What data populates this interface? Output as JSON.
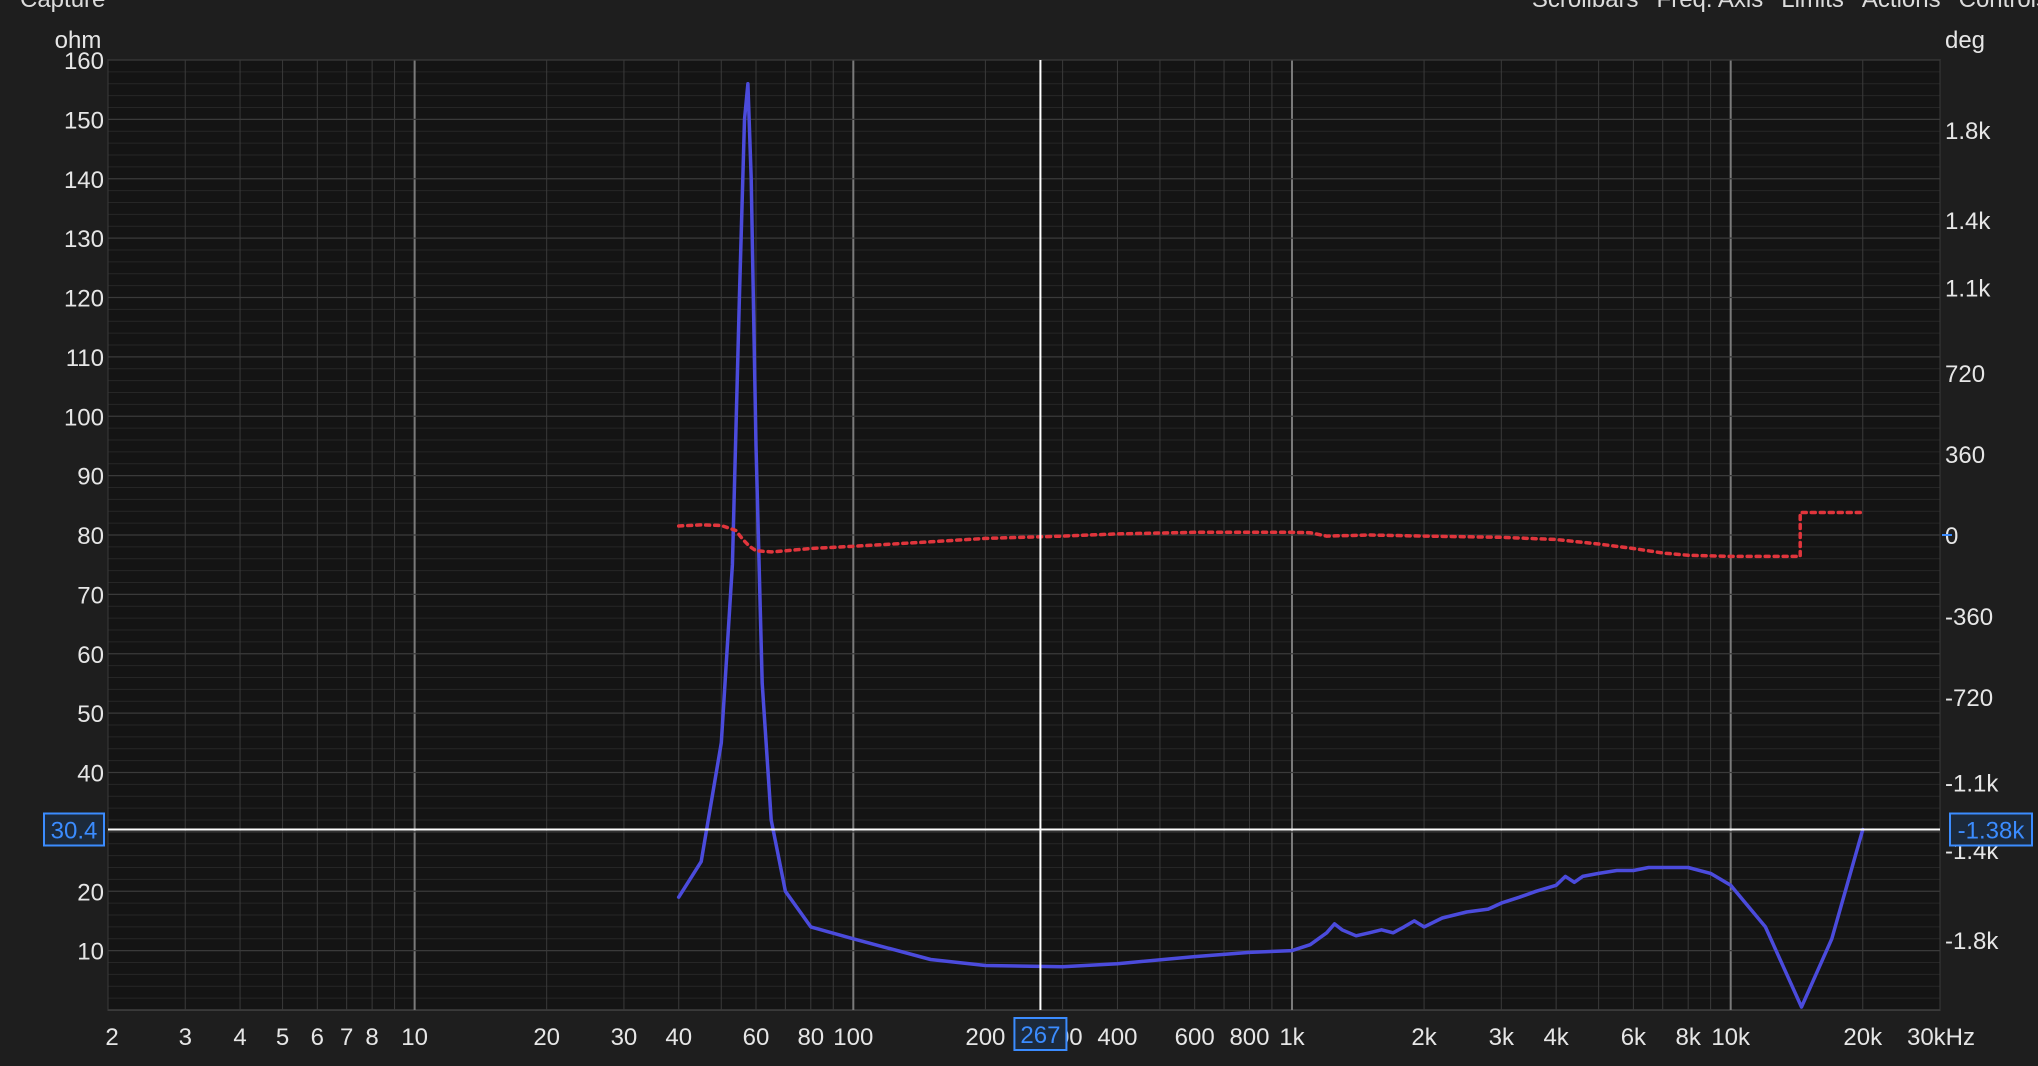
{
  "window": {
    "title": "Capture",
    "menu": [
      "Scrollbars",
      "Freq. Axis",
      "Limits",
      "Actions",
      "Controls"
    ]
  },
  "colors": {
    "background": "#1e1e1e",
    "plot_bg": "#141414",
    "grid": "#3a3a3a",
    "grid_major": "#7a7a7a",
    "impedance": "#4b4bdc",
    "phase": "#e0353c",
    "cursor": "#ffffff",
    "readout": "#3b8cff"
  },
  "chart_data": {
    "type": "line",
    "xscale": "log",
    "xlim": [
      2,
      30000
    ],
    "xticks": [
      2,
      3,
      4,
      5,
      6,
      7,
      8,
      10,
      20,
      30,
      40,
      60,
      80,
      100,
      200,
      300,
      400,
      600,
      800,
      1000,
      2000,
      3000,
      4000,
      6000,
      8000,
      10000,
      20000,
      30000
    ],
    "xtick_labels": [
      "2",
      "3",
      "4",
      "5",
      "6",
      "7",
      "8",
      "10",
      "20",
      "30",
      "40",
      "60",
      "80",
      "100",
      "200",
      "300",
      "400",
      "600",
      "800",
      "1k",
      "2k",
      "3k",
      "4k",
      "6k",
      "8k",
      "10k",
      "20k",
      "30kHz"
    ],
    "ylabel_left": "ohm",
    "ylim_left": [
      0,
      160
    ],
    "yticks_left": [
      10,
      20,
      30,
      40,
      50,
      60,
      70,
      80,
      90,
      100,
      110,
      120,
      130,
      140,
      150,
      160
    ],
    "ylabel_right": "deg",
    "ylim_right": [
      -2110,
      2110
    ],
    "yticks_right": [
      1800,
      1400,
      1100,
      720,
      360,
      0,
      -360,
      -720,
      -1100,
      -1400,
      -1800
    ],
    "ytick_labels_right": [
      "1.8k",
      "1.4k",
      "1.1k",
      "720",
      "360",
      "0",
      "-360",
      "-720",
      "-1.1k",
      "-1.4k",
      "-1.8k"
    ],
    "grid": true,
    "series": [
      {
        "axis": "left",
        "style": "solid",
        "x": [
          40,
          45,
          50,
          53,
          55,
          56.5,
          57.5,
          58.5,
          60,
          62,
          65,
          70,
          80,
          100,
          150,
          200,
          300,
          400,
          600,
          800,
          1000,
          1100,
          1200,
          1250,
          1300,
          1400,
          1500,
          1600,
          1700,
          1800,
          1900,
          2000,
          2200,
          2500,
          2800,
          3000,
          3300,
          3600,
          4000,
          4200,
          4400,
          4600,
          5000,
          5500,
          6000,
          6500,
          7000,
          7500,
          8000,
          9000,
          10000,
          12000,
          14500,
          17000,
          20000
        ],
        "y": [
          19,
          25,
          45,
          75,
          120,
          150,
          156,
          140,
          95,
          55,
          32,
          20,
          14,
          12,
          8.5,
          7.5,
          7.3,
          7.8,
          9,
          9.7,
          10,
          11,
          13,
          14.5,
          13.5,
          12.5,
          13,
          13.5,
          13,
          14,
          15,
          14,
          15.5,
          16.5,
          17,
          18,
          19,
          20,
          21,
          22.5,
          21.5,
          22.5,
          23,
          23.5,
          23.5,
          24,
          24,
          24,
          24,
          23,
          21,
          14,
          0.5,
          12,
          30.4
        ]
      },
      {
        "axis": "right",
        "style": "dotted",
        "x": [
          40,
          45,
          50,
          54,
          56,
          58,
          60,
          65,
          70,
          80,
          100,
          150,
          200,
          300,
          400,
          600,
          800,
          1000,
          1100,
          1200,
          1500,
          2000,
          3000,
          4000,
          5000,
          6000,
          7000,
          8000,
          10000,
          12000,
          14400,
          14400,
          20000
        ],
        "y": [
          40,
          45,
          42,
          20,
          -20,
          -50,
          -70,
          -75,
          -70,
          -60,
          -50,
          -30,
          -15,
          -5,
          5,
          12,
          12,
          12,
          10,
          -5,
          0,
          -5,
          -10,
          -20,
          -40,
          -60,
          -80,
          -90,
          -95,
          -95,
          -95,
          100,
          100
        ]
      }
    ],
    "cursor": {
      "x": 267,
      "x_label": "267",
      "y_left": 30.4,
      "y_left_label": "30.4",
      "y_right_label": "-1.38k"
    }
  }
}
